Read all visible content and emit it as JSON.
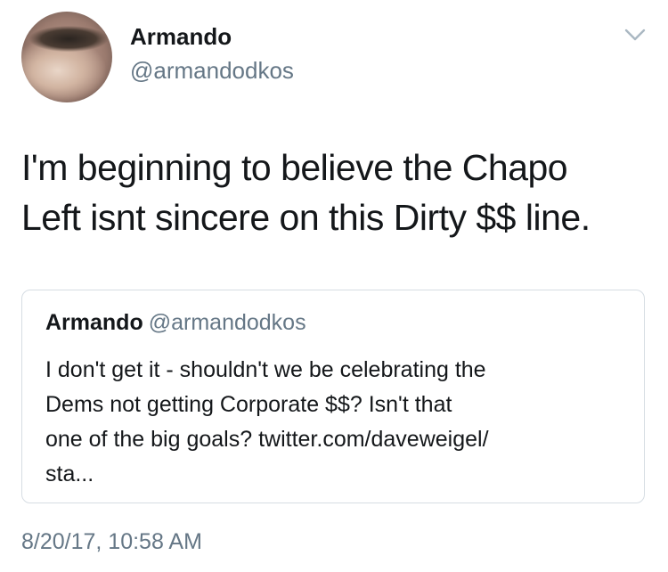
{
  "author": {
    "display_name": "Armando",
    "handle": "@armandodkos",
    "avatar_icon": "profile-avatar"
  },
  "menu_icon": "chevron-down-icon",
  "tweet": {
    "lines": [
      "I'm beginning to believe the Chapo",
      "Left isnt sincere on this Dirty $$ line."
    ],
    "timestamp": "8/20/17, 10:58 AM"
  },
  "quoted_tweet": {
    "display_name": "Armando",
    "handle": "@armandodkos",
    "lines": [
      "I don't get it - shouldn't we be celebrating the",
      "Dems not getting Corporate $$? Isn't that",
      "one of the big goals? twitter.com/daveweigel/",
      "sta..."
    ]
  },
  "colors": {
    "text_primary": "#14171a",
    "text_secondary": "#657786",
    "card_border": "#d6dde3"
  }
}
